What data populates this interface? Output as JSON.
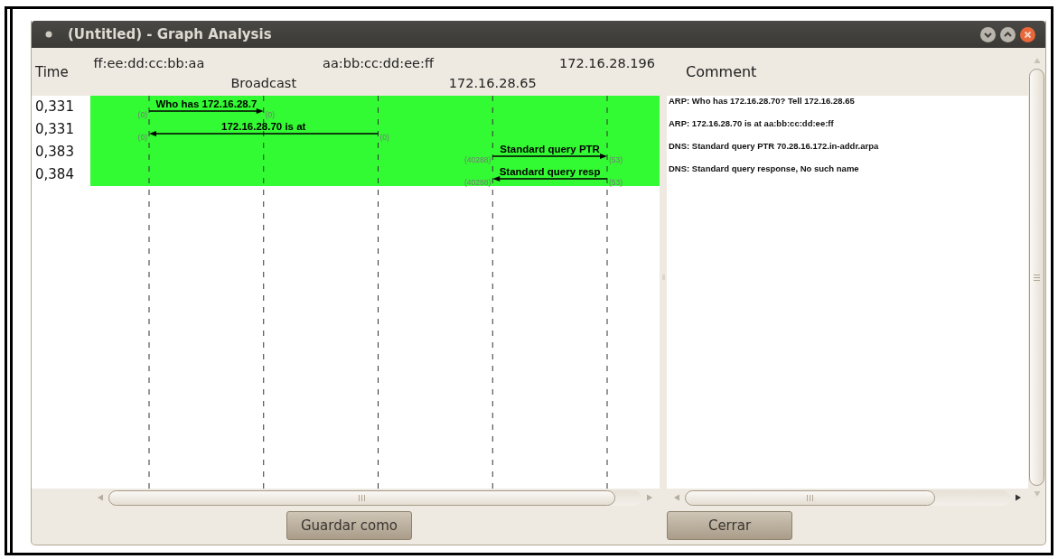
{
  "window": {
    "title": "(Untitled) - Graph Analysis"
  },
  "headers": {
    "time": "Time",
    "comment": "Comment"
  },
  "nodes": [
    {
      "label": "ff:ee:dd:cc:bb:aa"
    },
    {
      "label": "Broadcast"
    },
    {
      "label": "aa:bb:cc:dd:ee:ff"
    },
    {
      "label": "172.16.28.65"
    },
    {
      "label": "172.16.28.196"
    }
  ],
  "flows": [
    {
      "time": "0,331",
      "label": "Who has 172.16.28.7",
      "source_port": "(0)",
      "target_port": "(0)",
      "comment": "ARP: Who has 172.16.28.70?  Tell 172.16.28.65",
      "selected": true
    },
    {
      "time": "0,331",
      "label": "172.16.28.70 is at",
      "source_port": "(0)",
      "target_port": "(0)",
      "comment": "ARP: 172.16.28.70 is at aa:bb:cc:dd:ee:ff",
      "selected": true
    },
    {
      "time": "0,383",
      "label": "Standard query PTR",
      "source_port": "(40288)",
      "target_port": "(53)",
      "comment": "DNS: Standard query PTR 70.28.16.172.in-addr.arpa",
      "selected": true
    },
    {
      "time": "0,384",
      "label": "Standard query resp",
      "source_port": "(53)",
      "target_port": "(40288)",
      "comment": "DNS: Standard query response, No such name",
      "selected": true
    }
  ],
  "buttons": [
    {
      "label": "Guardar como"
    },
    {
      "label": "Cerrar"
    }
  ]
}
